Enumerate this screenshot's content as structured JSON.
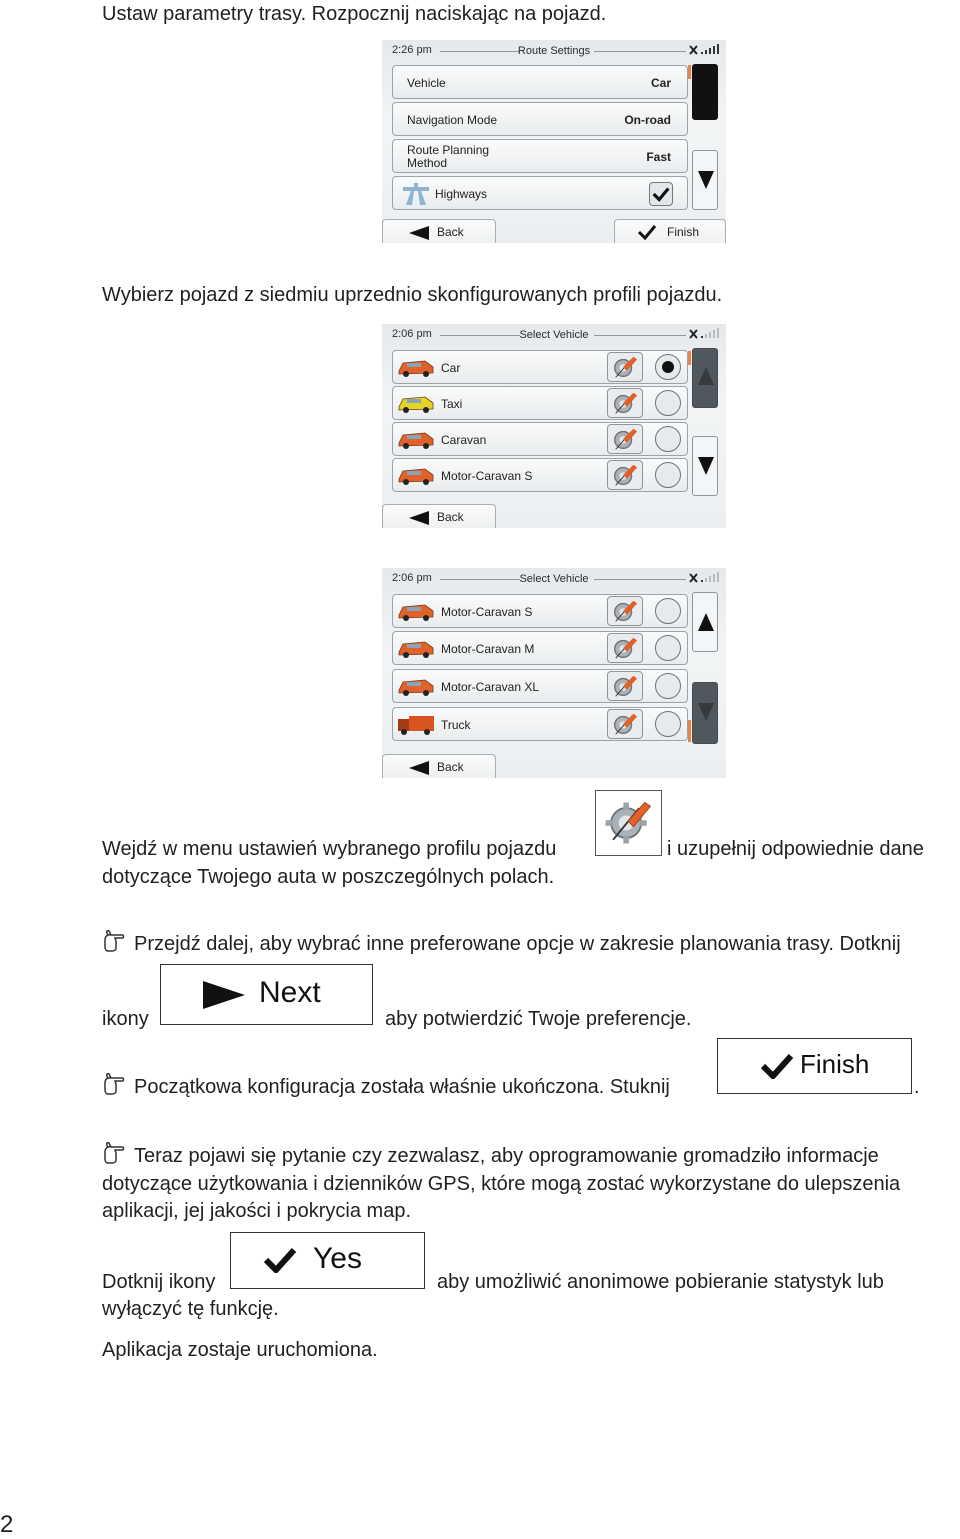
{
  "intro_text": "Ustaw parametry trasy. Rozpocznij naciskając na pojazd.",
  "route_settings_screen": {
    "time": "2:26 pm",
    "title": "Route Settings",
    "rows": [
      {
        "label": "Vehicle",
        "value": "Car"
      },
      {
        "label": "Navigation Mode",
        "value": "On-road"
      },
      {
        "label": "Route Planning Method",
        "value": "Fast"
      },
      {
        "label": "Highways",
        "checked": true
      }
    ],
    "back_label": "Back",
    "finish_label": "Finish"
  },
  "select_vehicle_text": "Wybierz pojazd z siedmiu uprzednio skonfigurowanych profili pojazdu.",
  "select_vehicle_screen_1": {
    "time": "2:06 pm",
    "title": "Select Vehicle",
    "vehicles": [
      {
        "name": "Car",
        "selected": true,
        "color": "#e0622a"
      },
      {
        "name": "Taxi",
        "selected": false,
        "color": "#e3d428"
      },
      {
        "name": "Caravan",
        "selected": false,
        "color": "#e0622a"
      },
      {
        "name": "Motor-Caravan S",
        "selected": false,
        "color": "#e0622a"
      }
    ],
    "back_label": "Back"
  },
  "select_vehicle_screen_2": {
    "time": "2:06 pm",
    "title": "Select Vehicle",
    "vehicles": [
      {
        "name": "Motor-Caravan S",
        "selected": false,
        "color": "#e0622a"
      },
      {
        "name": "Motor-Caravan M",
        "selected": false,
        "color": "#e0622a"
      },
      {
        "name": "Motor-Caravan XL",
        "selected": false,
        "color": "#e0622a"
      },
      {
        "name": "Truck",
        "selected": false,
        "color": "#d9551f"
      }
    ],
    "back_label": "Back"
  },
  "settings_para": {
    "before": "Wejdź w menu ustawień wybranego profilu pojazdu",
    "after": "i uzupełnij odpowiednie dane",
    "line2": "dotyczące Twojego auta w poszczególnych polach."
  },
  "next_para": {
    "line1": "Przejdź dalej, aby wybrać inne preferowane opcje w zakresie planowania trasy. Dotknij",
    "before": "ikony",
    "button_label": "Next",
    "after": "aby potwierdzić Twoje preferencje."
  },
  "finish_para": {
    "text": "Początkowa konfiguracja została właśnie ukończona. Stuknij",
    "button_label": "Finish",
    "after": "."
  },
  "stats_para": {
    "line1": "Teraz pojawi się pytanie czy zezwalasz, aby oprogramowanie gromadziło informacje",
    "line2": "dotyczące użytkowania i dzienników GPS, które mogą zostać wykorzystane do ulepszenia",
    "line3": "aplikacji, jej jakości i pokrycia map."
  },
  "yes_para": {
    "before": "Dotknij ikony",
    "button_label": "Yes",
    "after": "aby umożliwić anonimowe pobieranie statystyk lub",
    "line2": "wyłączyć tę funkcję."
  },
  "final_text": "Aplikacja zostaje uruchomiona.",
  "page_number": "2"
}
